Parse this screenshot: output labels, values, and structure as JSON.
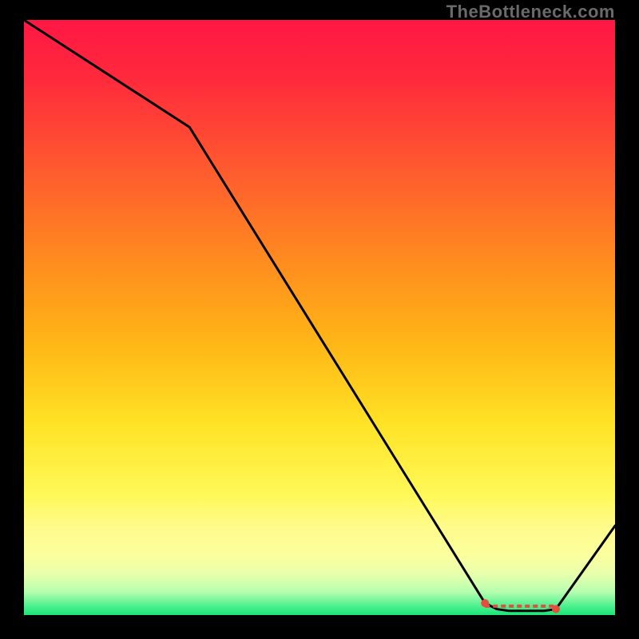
{
  "watermark": "TheBottleneck.com",
  "chart_data": {
    "type": "line",
    "title": "",
    "xlabel": "",
    "ylabel": "",
    "xlim": [
      0,
      100
    ],
    "ylim": [
      0,
      100
    ],
    "x": [
      0,
      28,
      78,
      80,
      82,
      84,
      86,
      88,
      90,
      100
    ],
    "values": [
      100,
      82,
      2,
      1,
      0.7,
      0.7,
      0.7,
      0.7,
      1,
      15
    ],
    "marker_region": {
      "from": 78,
      "to": 90
    },
    "gradient_stops": [
      {
        "offset": 0.0,
        "color": "#ff1744"
      },
      {
        "offset": 0.1,
        "color": "#ff2a3c"
      },
      {
        "offset": 0.25,
        "color": "#ff5a2f"
      },
      {
        "offset": 0.4,
        "color": "#ff8a1f"
      },
      {
        "offset": 0.55,
        "color": "#ffb816"
      },
      {
        "offset": 0.68,
        "color": "#ffe326"
      },
      {
        "offset": 0.8,
        "color": "#fff95a"
      },
      {
        "offset": 0.85,
        "color": "#fffb8a"
      },
      {
        "offset": 0.9,
        "color": "#fbff9e"
      },
      {
        "offset": 0.93,
        "color": "#e9ffab"
      },
      {
        "offset": 0.96,
        "color": "#b9ffb0"
      },
      {
        "offset": 0.985,
        "color": "#4df08f"
      },
      {
        "offset": 1.0,
        "color": "#19e676"
      }
    ],
    "line_color": "#000000",
    "marker_color": "#e74c3c"
  }
}
